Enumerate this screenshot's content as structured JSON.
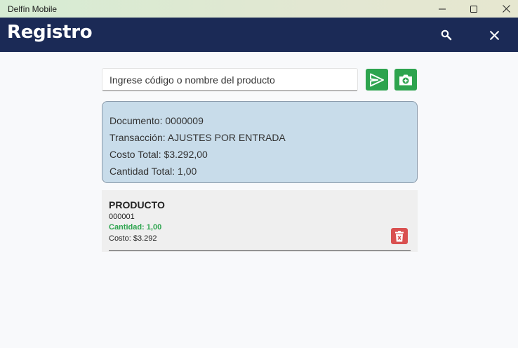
{
  "window": {
    "title": "Delfín Mobile"
  },
  "appbar": {
    "title": "Registro",
    "search_icon": "magnifier-icon",
    "close_icon": "close-icon"
  },
  "search": {
    "placeholder": "Ingrese código o nombre del producto",
    "value": ""
  },
  "actions": {
    "send_icon": "send-arrow-icon",
    "camera_icon": "camera-add-icon"
  },
  "summary": {
    "documento": "Documento: 0000009",
    "transaccion": "Transacción: AJUSTES POR ENTRADA",
    "costo_total": "Costo Total: $3.292,00",
    "cantidad_total": "Cantidad Total: 1,00"
  },
  "items": [
    {
      "name": "PRODUCTO",
      "code": "000001",
      "quantity": "Cantidad: 1,00",
      "cost": "Costo: $3.292",
      "delete_icon": "trash-icon"
    }
  ],
  "colors": {
    "appbar": "#1b2a56",
    "accent_green": "#2da44e",
    "delete_red": "#d95050",
    "card_bg": "#c8dcea"
  }
}
